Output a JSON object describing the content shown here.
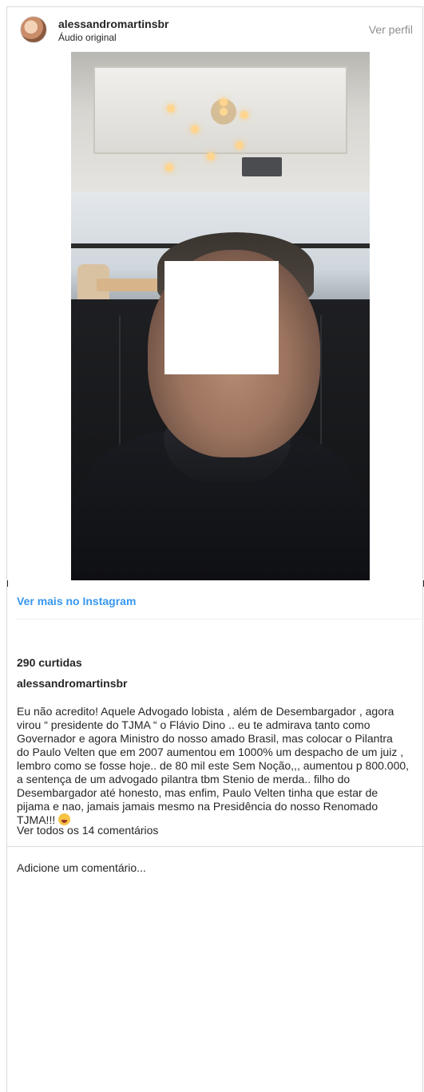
{
  "header": {
    "username": "alessandromartinsbr",
    "subtitle": "Áudio original",
    "view_profile_label": "Ver perfil"
  },
  "media": {
    "alt_icon": "video-frame"
  },
  "links": {
    "view_more": "Ver mais no Instagram"
  },
  "post": {
    "likes": "290 curtidas",
    "caption_username": "alessandromartinsbr",
    "caption_lines": [
      "Eu não acredito! Aquele Advogado lobista , além de Desembargador , agora",
      "virou “ presidente do TJMA “ o Flávio Dino .. eu te admirava tanto como",
      "Governador e agora Ministro do nosso amado Brasil, mas colocar o Pilantra",
      "do Paulo Velten que em 2007 aumentou em 1000% um despacho de um juiz ,",
      "lembro como se fosse hoje.. de 80 mil este Sem Noção,,, aumentou p 800.000,",
      "a sentença de um advogado pilantra tbm Stenio de merda.. filho do",
      "Desembargador até honesto, mas enfim, Paulo Velten tinha que estar de",
      "pijama e nao, jamais jamais mesmo na Presidência do nosso Renomado",
      "TJMA!!!"
    ],
    "view_comments": "Ver todos os 14 comentários"
  },
  "comment": {
    "placeholder": "Adicione um comentário..."
  },
  "colors": {
    "link_blue": "#3897f0",
    "muted": "#8e8e8e",
    "text": "#262626",
    "border": "#dbdbdb"
  }
}
